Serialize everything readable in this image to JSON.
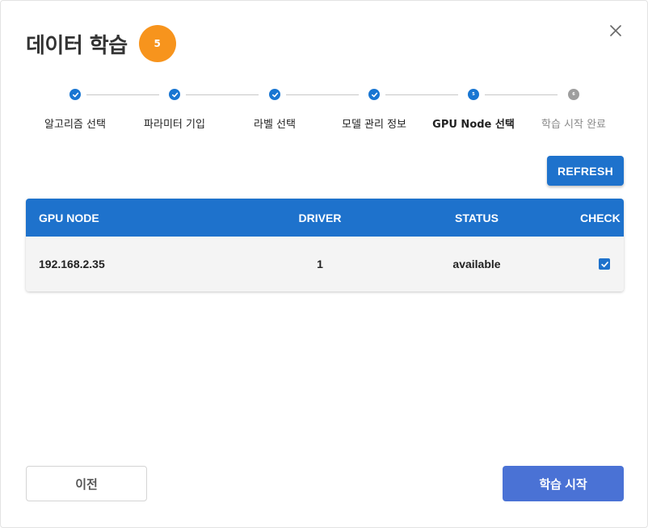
{
  "dialog": {
    "title": "데이터 학습",
    "step_badge": "5"
  },
  "stepper": {
    "steps": [
      {
        "label": "알고리즘 선택",
        "state": "done"
      },
      {
        "label": "파라미터 기입",
        "state": "done"
      },
      {
        "label": "라벨 선택",
        "state": "done"
      },
      {
        "label": "모델 관리 정보",
        "state": "done"
      },
      {
        "label": "GPU Node 선택",
        "state": "current",
        "number": "5"
      },
      {
        "label": "학습 시작 완료",
        "state": "pending",
        "number": "6"
      }
    ]
  },
  "toolbar": {
    "refresh_label": "REFRESH"
  },
  "table": {
    "headers": [
      "GPU NODE",
      "DRIVER",
      "STATUS",
      "CHECK"
    ],
    "rows": [
      {
        "gpu_node": "192.168.2.35",
        "driver": "1",
        "status": "available",
        "checked": true
      }
    ]
  },
  "footer": {
    "prev_label": "이전",
    "start_label": "학습 시작"
  },
  "colors": {
    "primary": "#1e72cc",
    "badge": "#f7941d",
    "start_button": "#4a72d5",
    "pending_step": "#9e9e9e"
  },
  "icons": {
    "close": "close-icon",
    "step_done": "check-icon",
    "row_check": "checkbox-checked-icon"
  }
}
